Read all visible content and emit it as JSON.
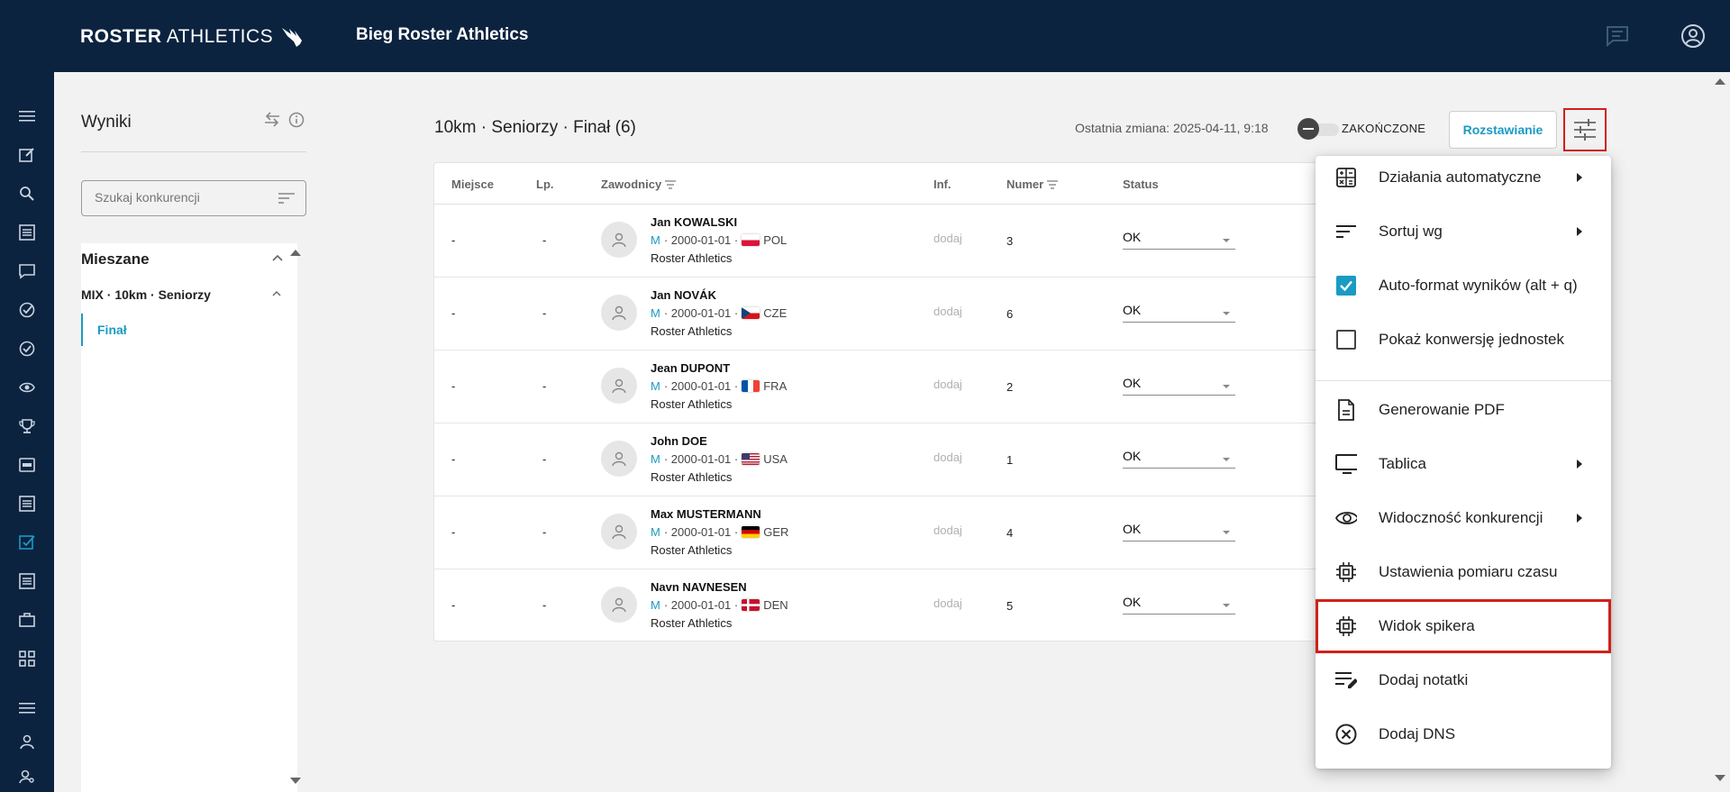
{
  "header": {
    "logo_bold": "ROSTER",
    "logo_light": " ATHLETICS",
    "title": "Bieg Roster Athletics",
    "bg_color": "#0c2340"
  },
  "rail": {
    "items": [
      "menu-icon",
      "edit-icon",
      "search-icon",
      "list-icon",
      "chat-icon",
      "check-circle-icon",
      "check-circle-icon",
      "eye-icon",
      "trophy-icon",
      "scoreboard-icon",
      "list-icon",
      "checkbox-icon",
      "list-icon",
      "briefcase-icon",
      "grid-icon",
      "menu-icon",
      "person-icon",
      "key-person-icon"
    ],
    "active": "checkbox-icon"
  },
  "panel": {
    "title": "Wyniki",
    "search_placeholder": "Szukaj konkurencji",
    "group": "Mieszane",
    "event": "MIX · 10km · Seniorzy",
    "round": "Finał"
  },
  "main": {
    "title": "10km · Seniorzy · Finał (6)",
    "last_change": "Ostatnia zmiana: 2025-04-11, 9:18",
    "status_toggle_label": "ZAKOŃCZONE",
    "start_list_button": "Rozstawianie"
  },
  "table": {
    "headers": {
      "place": "Miejsce",
      "lp": "Lp.",
      "athletes": "Zawodnicy",
      "inf": "Inf.",
      "number": "Numer",
      "status": "Status"
    },
    "rows": [
      {
        "place": "-",
        "lp": "-",
        "name": "Jan KOWALSKI",
        "sex": "M",
        "dob": "· 2000-01-01 ·",
        "country": "POL",
        "club": "Roster Athletics",
        "inf": "dodaj",
        "number": "3",
        "status": "OK"
      },
      {
        "place": "-",
        "lp": "-",
        "name": "Jan NOVÁK",
        "sex": "M",
        "dob": "· 2000-01-01 ·",
        "country": "CZE",
        "club": "Roster Athletics",
        "inf": "dodaj",
        "number": "6",
        "status": "OK"
      },
      {
        "place": "-",
        "lp": "-",
        "name": "Jean DUPONT",
        "sex": "M",
        "dob": "· 2000-01-01 ·",
        "country": "FRA",
        "club": "Roster Athletics",
        "inf": "dodaj",
        "number": "2",
        "status": "OK"
      },
      {
        "place": "-",
        "lp": "-",
        "name": "John DOE",
        "sex": "M",
        "dob": "· 2000-01-01 ·",
        "country": "USA",
        "club": "Roster Athletics",
        "inf": "dodaj",
        "number": "1",
        "status": "OK"
      },
      {
        "place": "-",
        "lp": "-",
        "name": "Max MUSTERMANN",
        "sex": "M",
        "dob": "· 2000-01-01 ·",
        "country": "GER",
        "club": "Roster Athletics",
        "inf": "dodaj",
        "number": "4",
        "status": "OK"
      },
      {
        "place": "-",
        "lp": "-",
        "name": "Navn NAVNESEN",
        "sex": "M",
        "dob": "· 2000-01-01 ·",
        "country": "DEN",
        "club": "Roster Athletics",
        "inf": "dodaj",
        "number": "5",
        "status": "OK"
      }
    ]
  },
  "menu": {
    "items": [
      {
        "label": "Działania automatyczne",
        "icon": "calculator-icon",
        "submenu": true
      },
      {
        "label": "Sortuj wg",
        "icon": "sort-icon",
        "submenu": true
      },
      {
        "label": "Auto-format wyników (alt + q)",
        "icon": "checkbox-checked-icon",
        "checked": true
      },
      {
        "label": "Pokaż konwersję jednostek",
        "icon": "checkbox-empty-icon",
        "checked": false
      },
      {
        "label": "Generowanie PDF",
        "icon": "document-icon"
      },
      {
        "label": "Tablica",
        "icon": "monitor-icon",
        "submenu": true
      },
      {
        "label": "Widoczność konkurencji",
        "icon": "eye-icon",
        "submenu": true
      },
      {
        "label": "Ustawienia pomiaru czasu",
        "icon": "chip-icon"
      },
      {
        "label": "Widok spikera",
        "icon": "chip-icon",
        "highlighted": true
      },
      {
        "label": "Dodaj notatki",
        "icon": "notes-edit-icon"
      },
      {
        "label": "Dodaj DNS",
        "icon": "cancel-circle-icon"
      }
    ]
  },
  "colors": {
    "accent": "#1a9bc4",
    "highlight": "#d0201a"
  }
}
